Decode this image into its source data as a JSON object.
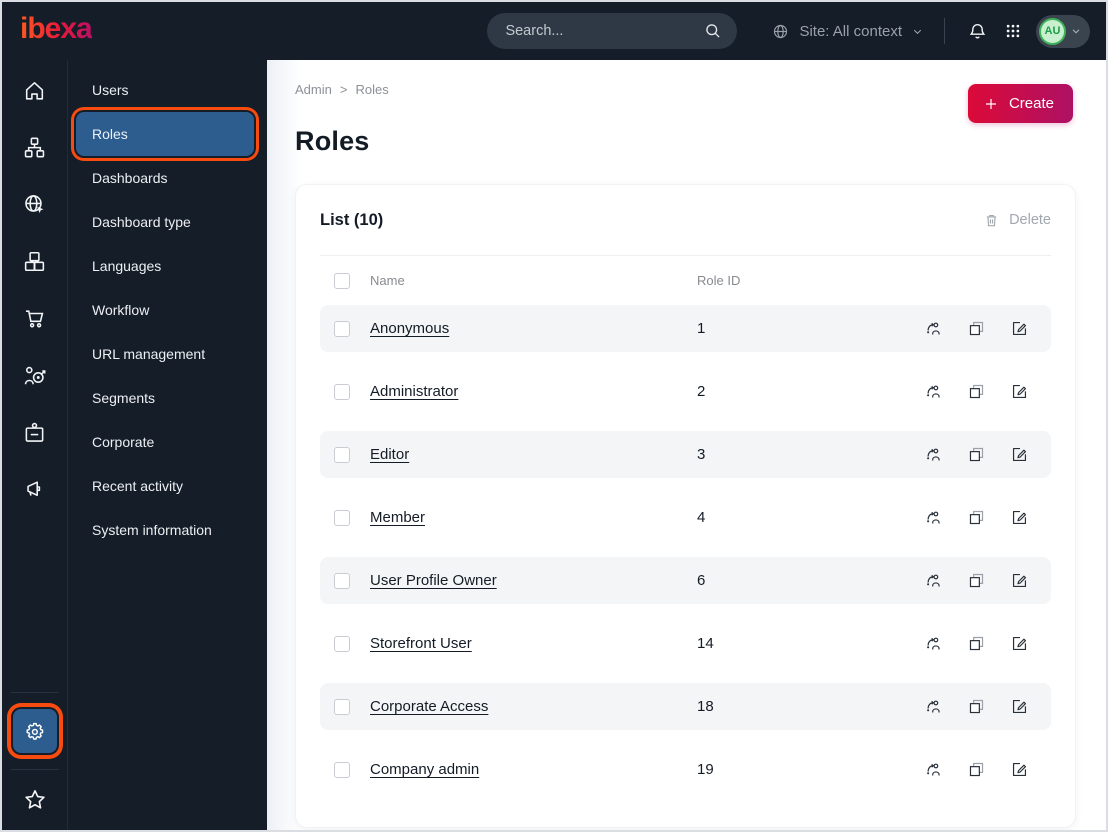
{
  "topbar": {
    "logo_text": "ibexa",
    "search": {
      "placeholder": "Search..."
    },
    "site_context_label": "Site: All context",
    "avatar_initials": "AU"
  },
  "sidebar": {
    "rail_icons": [
      "home-icon",
      "content-tree-icon",
      "site-globe-icon",
      "product-catalog-icon",
      "commerce-cart-icon",
      "personalization-target-icon",
      "customer-badge-icon",
      "marketing-megaphone-icon",
      "settings-gear-icon",
      "bookmarks-star-icon"
    ],
    "menu_items": [
      {
        "label": "Users",
        "active": false,
        "annotated": false
      },
      {
        "label": "Roles",
        "active": true,
        "annotated": true
      },
      {
        "label": "Dashboards",
        "active": false,
        "annotated": false
      },
      {
        "label": "Dashboard type",
        "active": false,
        "annotated": false
      },
      {
        "label": "Languages",
        "active": false,
        "annotated": false
      },
      {
        "label": "Workflow",
        "active": false,
        "annotated": false
      },
      {
        "label": "URL management",
        "active": false,
        "annotated": false
      },
      {
        "label": "Segments",
        "active": false,
        "annotated": false
      },
      {
        "label": "Corporate",
        "active": false,
        "annotated": false
      },
      {
        "label": "Recent activity",
        "active": false,
        "annotated": false
      },
      {
        "label": "System information",
        "active": false,
        "annotated": false
      }
    ]
  },
  "main": {
    "breadcrumb": {
      "items": [
        "Admin",
        "Roles"
      ],
      "separator": ">"
    },
    "page_title": "Roles",
    "create_button_label": "Create"
  },
  "list_card": {
    "title": "List (10)",
    "delete_label": "Delete",
    "columns": [
      "Name",
      "Role ID"
    ],
    "rows": [
      {
        "name": "Anonymous",
        "role_id": "1"
      },
      {
        "name": "Administrator",
        "role_id": "2"
      },
      {
        "name": "Editor",
        "role_id": "3"
      },
      {
        "name": "Member",
        "role_id": "4"
      },
      {
        "name": "User Profile Owner",
        "role_id": "6"
      },
      {
        "name": "Storefront User",
        "role_id": "14"
      },
      {
        "name": "Corporate Access",
        "role_id": "18"
      },
      {
        "name": "Company admin",
        "role_id": "19"
      }
    ]
  },
  "colors": {
    "topbar_bg": "#141D28",
    "selected_blue": "#2D5C8F",
    "annotation_orange": "#F84B10",
    "create_gradient_start": "#DB0A38",
    "create_gradient_end": "#AE1164",
    "row_alt_bg": "#F4F5F7",
    "avatar_green_bg": "#C8F0CE",
    "avatar_green_text": "#1D9C4B"
  }
}
